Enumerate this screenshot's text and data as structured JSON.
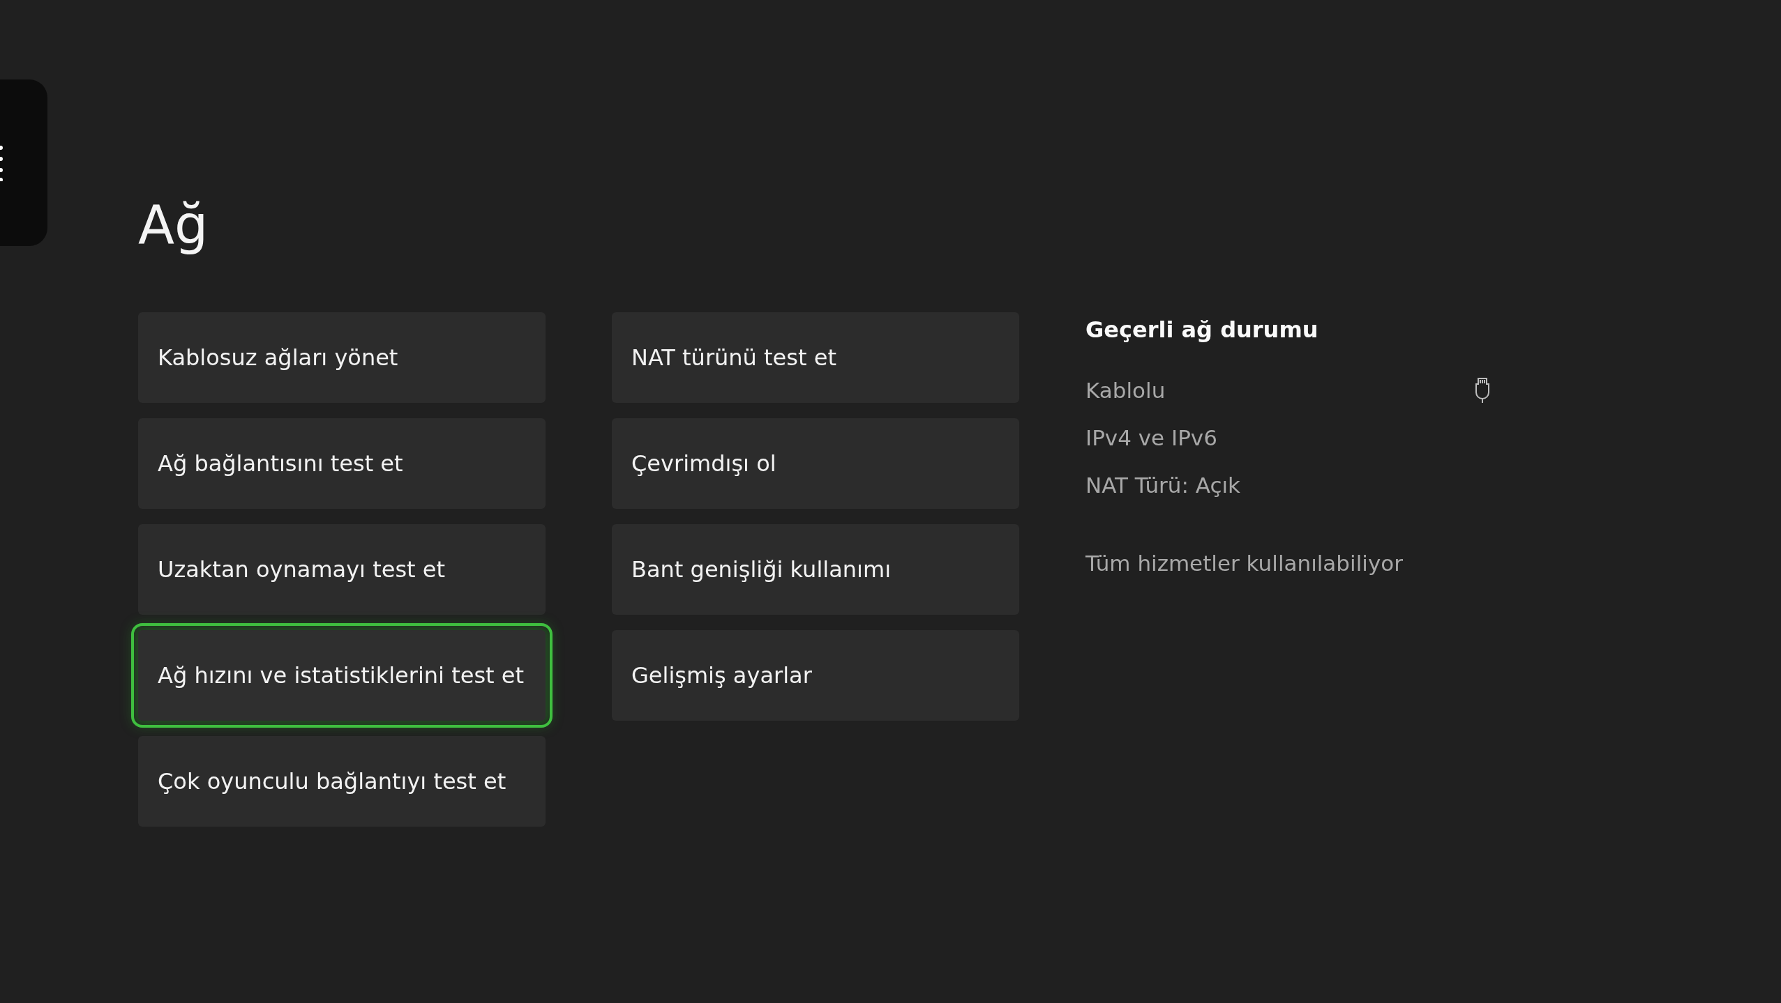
{
  "title": "Ağ",
  "menu_columns": [
    [
      {
        "label": "Kablosuz ağları yönet",
        "selected": false
      },
      {
        "label": "Ağ bağlantısını test et",
        "selected": false
      },
      {
        "label": "Uzaktan oynamayı test et",
        "selected": false
      },
      {
        "label": "Ağ hızını ve istatistiklerini test et",
        "selected": true
      },
      {
        "label": "Çok oyunculu bağlantıyı test et",
        "selected": false
      }
    ],
    [
      {
        "label": "NAT türünü test et",
        "selected": false
      },
      {
        "label": "Çevrimdışı ol",
        "selected": false
      },
      {
        "label": "Bant genişliği kullanımı",
        "selected": false
      },
      {
        "label": "Gelişmiş ayarlar",
        "selected": false
      }
    ]
  ],
  "status": {
    "heading": "Geçerli ağ durumu",
    "connection": "Kablolu",
    "protocol": "IPv4 ve IPv6",
    "nat": "NAT Türü: Açık",
    "services": "Tüm hizmetler kullanılabiliyor"
  }
}
